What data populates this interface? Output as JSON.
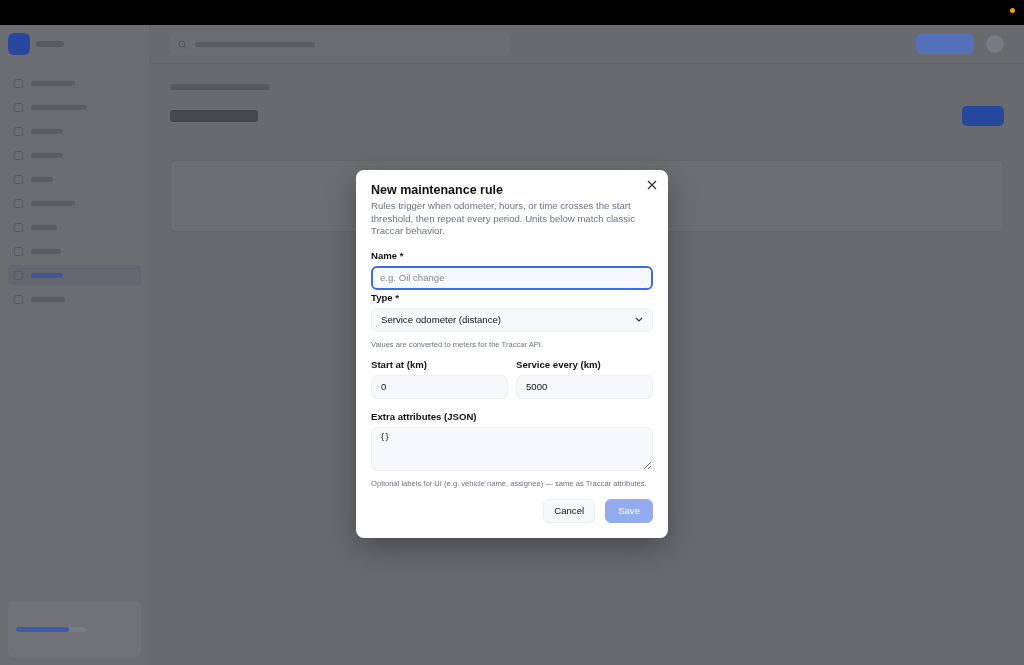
{
  "sidebar": {
    "items": [
      {
        "selected": false
      },
      {
        "selected": false
      },
      {
        "selected": false
      },
      {
        "selected": false
      },
      {
        "selected": false
      },
      {
        "selected": false
      },
      {
        "selected": false
      },
      {
        "selected": false
      },
      {
        "selected": true
      },
      {
        "selected": false
      }
    ],
    "usage": {
      "level": 0.75
    }
  },
  "dialog": {
    "title": "New maintenance rule",
    "description": "Rules trigger when odometer, hours, or time crosses the start threshold, then repeat every period. Units below match classic Traccar behavior.",
    "name": {
      "label": "Name *",
      "placeholder": "e.g. Oil change"
    },
    "type": {
      "label": "Type *",
      "value": "Service odometer (distance)",
      "hint": "Values are converted to meters for the Traccar API."
    },
    "start": {
      "label": "Start at (km)",
      "value": "0"
    },
    "period": {
      "label": "Service every (km)",
      "value": "5000"
    },
    "attributes": {
      "label": "Extra attributes (JSON)",
      "value": "{}",
      "hint": "Optional labels for UI (e.g. vehicle name, assignee) — same as Traccar attributes."
    },
    "buttons": [
      {
        "label": "Cancel",
        "kind": "secondary",
        "disabled": false
      },
      {
        "label": "Save",
        "kind": "primary",
        "disabled": true
      }
    ]
  }
}
